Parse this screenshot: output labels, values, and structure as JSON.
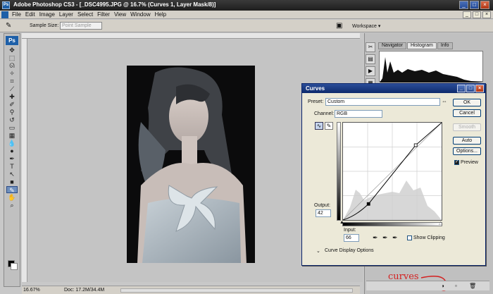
{
  "window": {
    "app_icon": "Ps",
    "title": "Adobe Photoshop CS3 - [_DSC4995.JPG @ 16.7% (Curves 1, Layer Mask/8)]",
    "buttons": [
      "_",
      "□",
      "×"
    ]
  },
  "menubar": {
    "items": [
      "File",
      "Edit",
      "Image",
      "Layer",
      "Select",
      "Filter",
      "View",
      "Window",
      "Help"
    ],
    "doc_buttons": [
      "_",
      "□",
      "×"
    ]
  },
  "options": {
    "tool_icon": "eyedropper-icon",
    "sample_size_label": "Sample Size:",
    "sample_size_value": "Point Sample",
    "workspace_label": "Workspace ▾"
  },
  "toolbox": {
    "logo": "Ps"
  },
  "status": {
    "zoom": "16.67%",
    "doc": "Doc: 17.2M/34.4M"
  },
  "panels": {
    "tabs": [
      "Navigator",
      "Histogram",
      "Info"
    ],
    "active_tab": "Histogram",
    "annotation": "curves"
  },
  "curves": {
    "title": "Curves",
    "preset_label": "Preset:",
    "preset_value": "Custom",
    "channel_label": "Channel:",
    "channel_value": "RGB",
    "buttons": {
      "ok": "OK",
      "cancel": "Cancel",
      "smooth": "Smooth",
      "auto": "Auto",
      "options": "Options..."
    },
    "preview_label": "Preview",
    "preview_checked": true,
    "output_label": "Output:",
    "output_value": "42",
    "input_label": "Input:",
    "input_value": "66",
    "show_clipping_label": "Show Clipping",
    "show_clipping_checked": false,
    "display_options_label": "Curve Display Options",
    "curve_points": [
      [
        0,
        0
      ],
      [
        66,
        42
      ],
      [
        188,
        196
      ],
      [
        255,
        255
      ]
    ]
  }
}
